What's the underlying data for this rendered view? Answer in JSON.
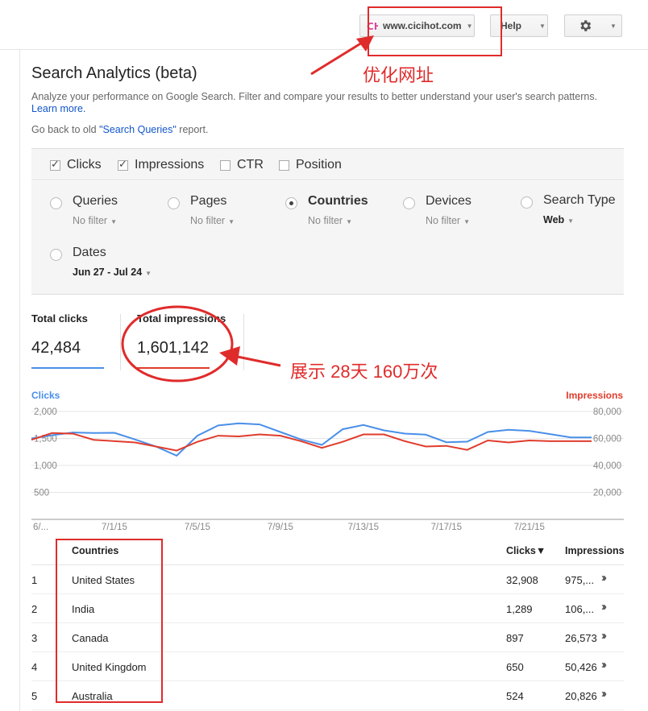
{
  "header": {
    "site_label": "www.cicihot.com",
    "help_label": "Help"
  },
  "annotations": {
    "site_note": "优化网址",
    "impressions_note": "展示 28天 160万次"
  },
  "page": {
    "title": "Search Analytics (beta)",
    "description": "Analyze your performance on Google Search. Filter and compare your results to better understand your user's search patterns.",
    "learn_more": "Learn more.",
    "back_prefix": "Go back to old ",
    "back_link": "\"Search Queries\"",
    "back_suffix": " report."
  },
  "metrics": [
    {
      "label": "Clicks",
      "checked": true
    },
    {
      "label": "Impressions",
      "checked": true
    },
    {
      "label": "CTR",
      "checked": false
    },
    {
      "label": "Position",
      "checked": false
    }
  ],
  "dimensions": [
    {
      "label": "Queries",
      "filter": "No filter",
      "selected": false
    },
    {
      "label": "Pages",
      "filter": "No filter",
      "selected": false
    },
    {
      "label": "Countries",
      "filter": "No filter",
      "selected": true
    },
    {
      "label": "Devices",
      "filter": "No filter",
      "selected": false
    },
    {
      "label": "Search Type",
      "filter": "Web",
      "selected": false
    },
    {
      "label": "Dates",
      "filter": "Jun 27 - Jul 24",
      "selected": false
    }
  ],
  "totals": {
    "clicks_label": "Total clicks",
    "clicks_value": "42,484",
    "impressions_label": "Total impressions",
    "impressions_value": "1,601,142"
  },
  "colors": {
    "clicks": "#4a8fe8",
    "impressions": "#e03c2c",
    "annotation": "#e02b2b"
  },
  "chart_data": {
    "type": "line",
    "left_axis_label": "Clicks",
    "right_axis_label": "Impressions",
    "left_ticks": [
      "2,000",
      "1,500",
      "1,000",
      "500"
    ],
    "right_ticks": [
      "80,000",
      "60,000",
      "40,000",
      "20,000"
    ],
    "left_ylim": [
      0,
      2000
    ],
    "right_ylim": [
      0,
      80000
    ],
    "x_tick_labels": [
      "6/...",
      "7/1/15",
      "7/5/15",
      "7/9/15",
      "7/13/15",
      "7/17/15",
      "7/21/15"
    ],
    "x": [
      "6/27",
      "6/28",
      "6/29",
      "6/30",
      "7/1",
      "7/2",
      "7/3",
      "7/4",
      "7/5",
      "7/6",
      "7/7",
      "7/8",
      "7/9",
      "7/10",
      "7/11",
      "7/12",
      "7/13",
      "7/14",
      "7/15",
      "7/16",
      "7/17",
      "7/18",
      "7/19",
      "7/20",
      "7/21",
      "7/22",
      "7/23",
      "7/24"
    ],
    "series": [
      {
        "name": "Clicks",
        "values": [
          1500,
          1560,
          1610,
          1600,
          1605,
          1480,
          1350,
          1180,
          1550,
          1740,
          1780,
          1760,
          1620,
          1480,
          1380,
          1670,
          1750,
          1650,
          1590,
          1570,
          1430,
          1440,
          1620,
          1660,
          1640,
          1580,
          1520,
          1520
        ]
      },
      {
        "name": "Impressions",
        "values": [
          59000,
          64000,
          63500,
          59000,
          58000,
          57000,
          54000,
          51000,
          57500,
          62000,
          61500,
          63000,
          62000,
          58000,
          53000,
          57500,
          63000,
          63000,
          58000,
          54000,
          54500,
          51500,
          58500,
          57000,
          58500,
          58000,
          58000,
          58000
        ]
      }
    ]
  },
  "table": {
    "col_country": "Countries",
    "col_clicks": "Clicks▼",
    "col_impressions": "Impressions",
    "rows": [
      {
        "rank": "1",
        "country": "United States",
        "clicks": "32,908",
        "impressions": "975,..."
      },
      {
        "rank": "2",
        "country": "India",
        "clicks": "1,289",
        "impressions": "106,..."
      },
      {
        "rank": "3",
        "country": "Canada",
        "clicks": "897",
        "impressions": "26,573"
      },
      {
        "rank": "4",
        "country": "United Kingdom",
        "clicks": "650",
        "impressions": "50,426"
      },
      {
        "rank": "5",
        "country": "Australia",
        "clicks": "524",
        "impressions": "20,826"
      }
    ]
  }
}
